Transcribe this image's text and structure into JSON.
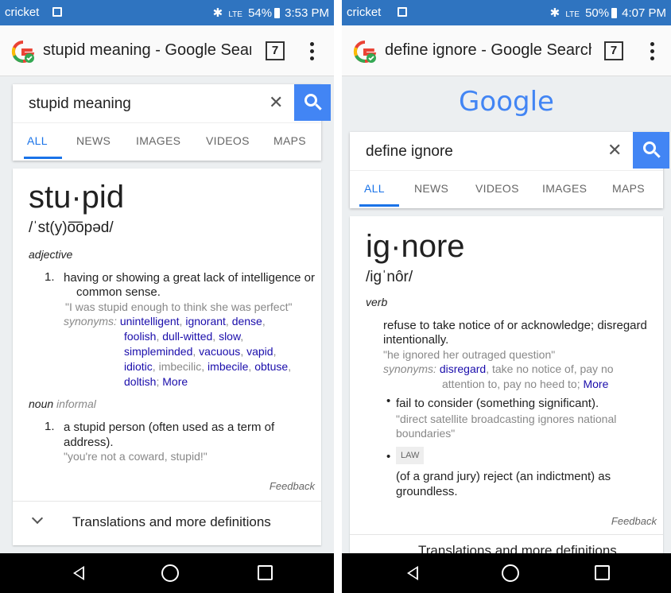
{
  "left": {
    "status": {
      "carrier": "cricket",
      "signal": "LTE",
      "battery": "54%",
      "time": "3:53 PM"
    },
    "app_title": "stupid meaning - Google Searc",
    "tab_count": "7",
    "search_query": "stupid meaning",
    "tabs": [
      "ALL",
      "NEWS",
      "IMAGES",
      "VIDEOS",
      "MAPS"
    ],
    "word": "stu·pid",
    "phonetic": "/ˈst(y)o͞opəd/",
    "pos_adj": "adjective",
    "def1_num": "1.",
    "def1_l1": "having or showing a great lack of intelligence or",
    "def1_l2": "common sense.",
    "def1_ex": "\"I was stupid enough to think she was perfect\"",
    "syn_label": "synonyms:",
    "syn_l1": [
      "unintelligent",
      "ignorant",
      "dense"
    ],
    "syn_l2": [
      "foolish",
      "dull-witted",
      "slow"
    ],
    "syn_l3": [
      "simpleminded",
      "vacuous",
      "vapid"
    ],
    "syn_l4a": "idiotic",
    "syn_l4b": "imbecilic",
    "syn_l4c": "imbecile",
    "syn_l4d": "obtuse",
    "syn_l5": "doltish",
    "more": "More",
    "pos_noun": "noun",
    "pos_noun_sub": "informal",
    "def2_num": "1.",
    "def2_l1": "a stupid person (often used as a term of",
    "def2_l2": "address).",
    "def2_ex": "\"you're not a coward, stupid!\"",
    "feedback": "Feedback",
    "translations": "Translations and more definitions"
  },
  "right": {
    "status": {
      "carrier": "cricket",
      "signal": "LTE",
      "battery": "50%",
      "time": "4:07 PM"
    },
    "app_title": "define ignore - Google Search",
    "tab_count": "7",
    "google_logo": "Google",
    "search_query": "define ignore",
    "tabs": [
      "ALL",
      "NEWS",
      "VIDEOS",
      "IMAGES",
      "MAPS"
    ],
    "word": "ig·nore",
    "phonetic": "/igˈnôr/",
    "pos": "verb",
    "def1_l1": "refuse to take notice of or acknowledge; disregard",
    "def1_l2": "intentionally.",
    "def1_ex": "\"he ignored her outraged question\"",
    "syn_label": "synonyms:",
    "syn_a": "disregard",
    "syn_b": "take no notice of, pay no",
    "syn_c": "attention to, pay no heed to;",
    "more": "More",
    "sub1_l1": "fail to consider (something significant).",
    "sub1_ex1": "\"direct satellite broadcasting ignores national",
    "sub1_ex2": "boundaries\"",
    "law_tag": "LAW",
    "sub2_l1": "(of a grand jury) reject (an indictment) as",
    "sub2_l2": "groundless.",
    "feedback": "Feedback",
    "translations": "Translations and more definitions"
  },
  "colors": {
    "status_bar": "#2f74c0",
    "accent": "#4285f4",
    "link": "#1a0dab",
    "tab_active": "#1a73e8"
  },
  "icons": [
    "back-icon",
    "home-icon",
    "recents-icon",
    "search-icon",
    "close-icon",
    "menu-dots-icon",
    "chevron-down-icon",
    "google-app-icon"
  ]
}
